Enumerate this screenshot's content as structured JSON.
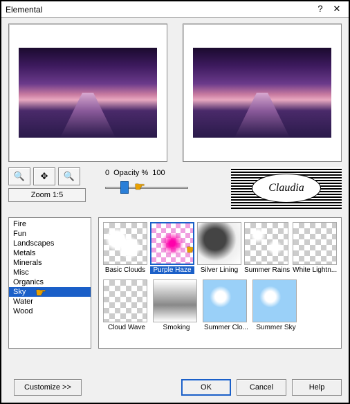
{
  "window": {
    "title": "Elemental"
  },
  "zoom": {
    "label": "Zoom 1:5",
    "zoom_in_icon": "zoom-in-icon",
    "move_icon": "move-icon",
    "zoom_out_icon": "zoom-out-icon"
  },
  "opacity": {
    "min": "0",
    "label": "Opacity %",
    "value": "100"
  },
  "watermark": {
    "text": "Claudia"
  },
  "categories": {
    "items": [
      {
        "label": "Fire"
      },
      {
        "label": "Fun"
      },
      {
        "label": "Landscapes"
      },
      {
        "label": "Metals"
      },
      {
        "label": "Minerals"
      },
      {
        "label": "Misc"
      },
      {
        "label": "Organics"
      },
      {
        "label": "Sky",
        "selected": true
      },
      {
        "label": "Water"
      },
      {
        "label": "Wood"
      }
    ]
  },
  "thumbnails": {
    "row1": [
      {
        "label": "Basic Clouds",
        "style": "clouds"
      },
      {
        "label": "Purple Haze",
        "style": "haze",
        "selected": true
      },
      {
        "label": "Silver Lining",
        "style": "silver"
      },
      {
        "label": "Summer Rains",
        "style": "rains"
      },
      {
        "label": "White Lightn...",
        "style": "checker"
      }
    ],
    "row2": [
      {
        "label": "Cloud Wave",
        "style": "checker"
      },
      {
        "label": "Smoking",
        "style": "smoking"
      },
      {
        "label": "Summer Clo...",
        "style": "bluecloud"
      },
      {
        "label": "Summer Sky",
        "style": "bluecloud"
      }
    ]
  },
  "buttons": {
    "customize": "Customize   >>",
    "ok": "OK",
    "cancel": "Cancel",
    "help": "Help"
  }
}
